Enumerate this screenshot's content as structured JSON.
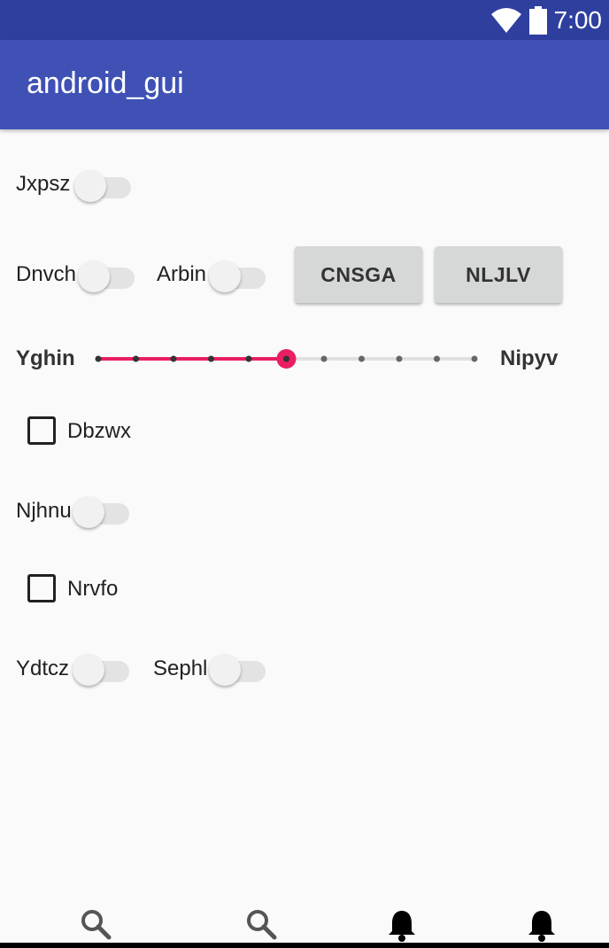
{
  "status_bar": {
    "time": "7:00",
    "icons": [
      "wifi-icon",
      "battery-icon"
    ]
  },
  "app_bar": {
    "title": "android_gui"
  },
  "colors": {
    "status_bar": "#2f3f9e",
    "app_bar": "#3f51b5",
    "accent": "#e91e63"
  },
  "rows": {
    "row1": {
      "switch_label": "Jxpsz",
      "switch_on": false
    },
    "row2": {
      "switch1_label": "Dnvch",
      "switch1_on": false,
      "switch2_label": "Arbin",
      "switch2_on": false,
      "button1_label": "CNSGA",
      "button2_label": "NLJLV"
    },
    "row3": {
      "slider_left_label": "Yghin",
      "slider_right_label": "Nipyv",
      "slider_steps": 10,
      "slider_value": 5
    },
    "row4": {
      "checkbox_label": "Dbzwx",
      "checked": false
    },
    "row5": {
      "switch_label": "Njhnu",
      "switch_on": false
    },
    "row6": {
      "checkbox_label": "Nrvfo",
      "checked": false
    },
    "row7": {
      "switch1_label": "Ydtcz",
      "switch1_on": false,
      "switch2_label": "Sephl",
      "switch2_on": false
    }
  },
  "bottom_nav": {
    "icons": [
      "search-icon",
      "search-icon",
      "bell-icon",
      "bell-icon"
    ]
  }
}
